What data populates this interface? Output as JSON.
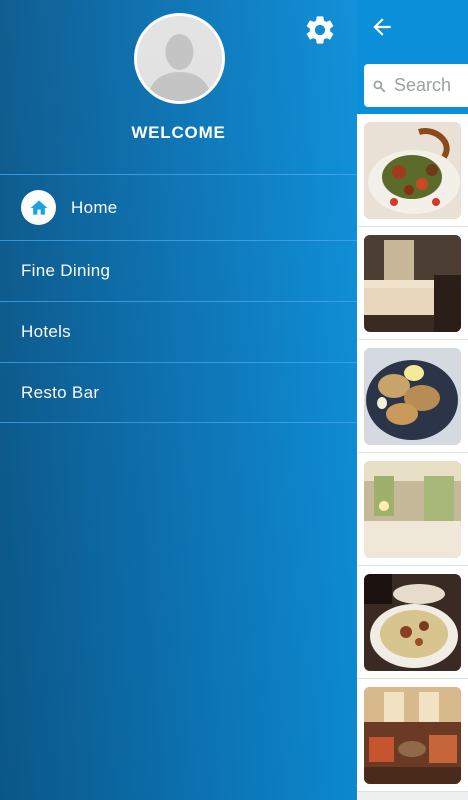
{
  "drawer": {
    "welcome_text": "WELCOME",
    "settings_icon": "gear-icon",
    "avatar_icon": "person-silhouette-icon",
    "menu": [
      {
        "label": "Home",
        "icon": "home-icon"
      },
      {
        "label": "Fine Dining"
      },
      {
        "label": "Hotels"
      },
      {
        "label": "Resto Bar"
      }
    ]
  },
  "background_app": {
    "back_icon": "arrow-left-icon",
    "search_placeholder": "Search",
    "thumbnails": [
      "food-salad-photo",
      "hotel-room-photo",
      "oysters-photo",
      "bedroom-photo",
      "dish-bowl-photo",
      "lounge-photo"
    ]
  },
  "colors": {
    "drawer_gradient_start": "#0b5b8e",
    "drawer_gradient_end": "#0d8fd9",
    "app_bar": "#0a8fd8",
    "home_icon": "#16a3e0"
  }
}
